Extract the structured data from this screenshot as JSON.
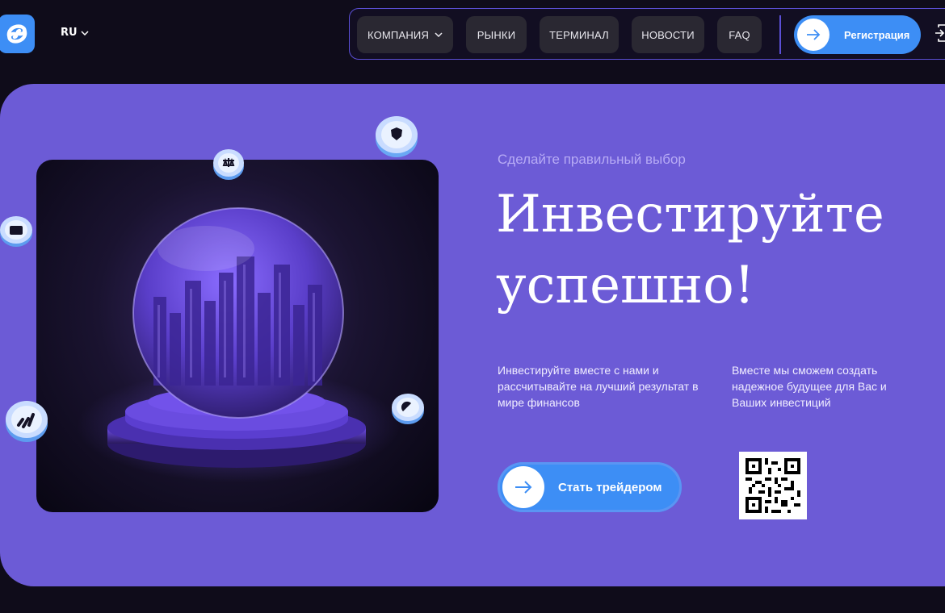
{
  "header": {
    "logo_icon": "swirl-logo-icon",
    "lang": "RU",
    "nav": [
      {
        "label": "КОМПАНИЯ",
        "has_dropdown": true
      },
      {
        "label": "РЫНКИ"
      },
      {
        "label": "ТЕРМИНАЛ"
      },
      {
        "label": "НОВОСТИ"
      },
      {
        "label": "FAQ"
      }
    ],
    "register_label": "Регистрация"
  },
  "hero": {
    "eyebrow": "Сделайте правильный выбор",
    "headline": "Инвестируйте успешно!",
    "desc_left": "Инвестируйте вместе с нами и рассчитывайте на лучший результат в мире финансов",
    "desc_right": "Вместе мы сможем создать надежное будущее для Вас и Ваших инвестиций",
    "cta_label": "Стать трейдером"
  },
  "colors": {
    "page_bg": "#0f0c1a",
    "hero_bg": "#6c5bd6",
    "accent_blue": "#3d8ef5",
    "nav_border": "#5b4fd6"
  }
}
